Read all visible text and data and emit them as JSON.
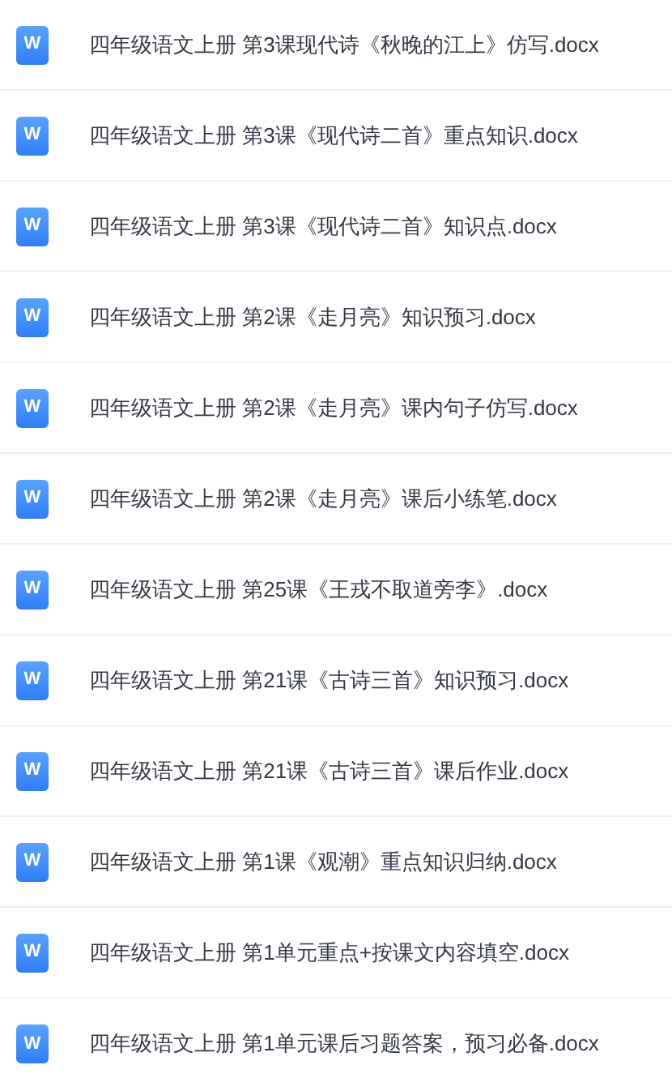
{
  "files": [
    {
      "icon_text": "W",
      "name": "四年级语文上册 第3课现代诗《秋晚的江上》仿写.docx"
    },
    {
      "icon_text": "W",
      "name": "四年级语文上册 第3课《现代诗二首》重点知识.docx"
    },
    {
      "icon_text": "W",
      "name": "四年级语文上册 第3课《现代诗二首》知识点.docx"
    },
    {
      "icon_text": "W",
      "name": "四年级语文上册 第2课《走月亮》知识预习.docx"
    },
    {
      "icon_text": "W",
      "name": "四年级语文上册 第2课《走月亮》课内句子仿写.docx"
    },
    {
      "icon_text": "W",
      "name": "四年级语文上册 第2课《走月亮》课后小练笔.docx"
    },
    {
      "icon_text": "W",
      "name": "四年级语文上册 第25课《王戎不取道旁李》.docx"
    },
    {
      "icon_text": "W",
      "name": "四年级语文上册 第21课《古诗三首》知识预习.docx"
    },
    {
      "icon_text": "W",
      "name": "四年级语文上册 第21课《古诗三首》课后作业.docx"
    },
    {
      "icon_text": "W",
      "name": "四年级语文上册 第1课《观潮》重点知识归纳.docx"
    },
    {
      "icon_text": "W",
      "name": "四年级语文上册 第1单元重点+按课文内容填空.docx"
    },
    {
      "icon_text": "W",
      "name": "四年级语文上册 第1单元课后习题答案，预习必备.docx"
    }
  ]
}
